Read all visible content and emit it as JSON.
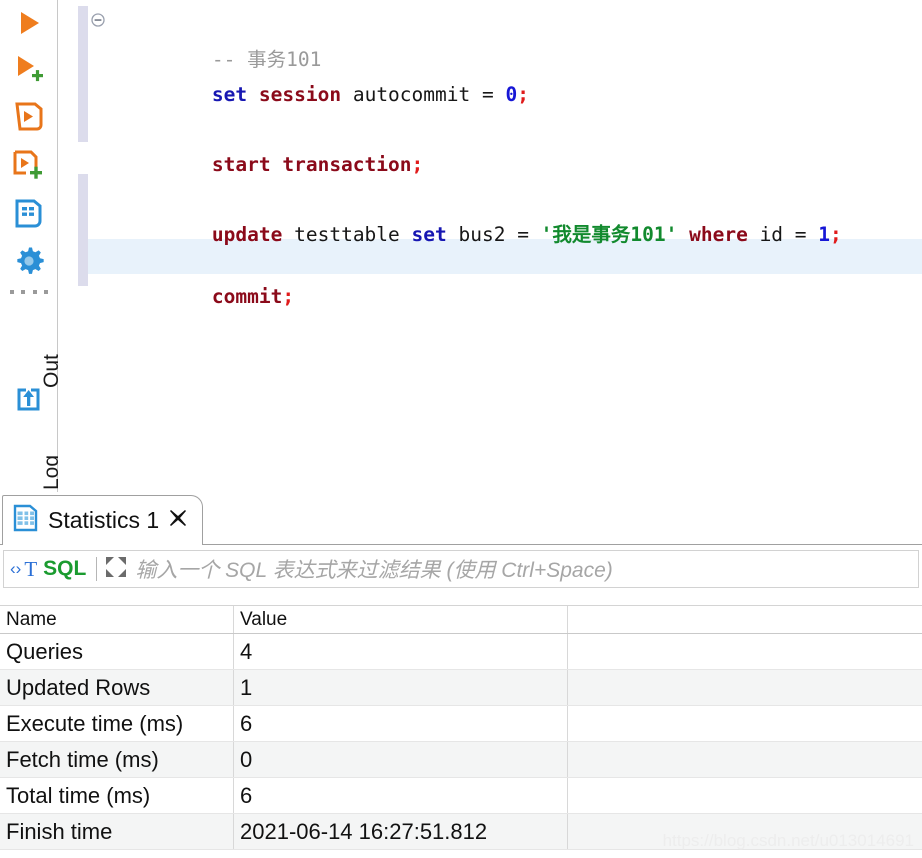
{
  "toolbar": {
    "items": [
      {
        "name": "execute-sql-statement-button",
        "icon": "play-icon",
        "title": "Execute SQL Statement"
      },
      {
        "name": "execute-sql-new-tab-button",
        "icon": "play-plus-icon",
        "title": "Execute SQL in new tab"
      },
      {
        "name": "execute-script-button",
        "icon": "script-execute-icon",
        "title": "Execute script"
      },
      {
        "name": "execute-script-new-tab-button",
        "icon": "script-execute-plus-icon",
        "title": "Execute script in new tab"
      },
      {
        "name": "explain-execution-plan-button",
        "icon": "execution-plan-icon",
        "title": "Explain execution plan"
      },
      {
        "name": "sql-editor-settings-button",
        "icon": "gear-icon",
        "title": "SQL Editor settings"
      }
    ],
    "drag_handle": "drag-dots-handle",
    "vertical_labels": [
      {
        "name": "output-panel-label",
        "text": "Out"
      },
      {
        "name": "log-panel-label",
        "text": "Log"
      }
    ],
    "output_icon": "export-output-icon"
  },
  "editor": {
    "fold_icon": "fold-collapse-icon",
    "lines": [
      {
        "name": "code-line-comment",
        "tokens": [
          {
            "t": "-- 事务101",
            "c": "tk-comment"
          }
        ]
      },
      {
        "name": "code-line-set-autocommit",
        "tokens": [
          {
            "t": "set",
            "c": "tk-kw-blue"
          },
          {
            "t": " ",
            "c": "tk-plain"
          },
          {
            "t": "session",
            "c": "tk-kw-red"
          },
          {
            "t": " autocommit = ",
            "c": "tk-plain"
          },
          {
            "t": "0",
            "c": "tk-num"
          },
          {
            "t": ";",
            "c": "tk-semi"
          }
        ]
      },
      {
        "name": "code-line-start-transaction",
        "tokens": [
          {
            "t": "start transaction",
            "c": "tk-kw-red"
          },
          {
            "t": ";",
            "c": "tk-semi"
          }
        ]
      },
      {
        "name": "code-line-update",
        "tokens": [
          {
            "t": "update",
            "c": "tk-kw-red"
          },
          {
            "t": " testtable ",
            "c": "tk-plain"
          },
          {
            "t": "set",
            "c": "tk-kw-blue"
          },
          {
            "t": " bus2 = ",
            "c": "tk-plain"
          },
          {
            "t": "'我是事务101'",
            "c": "tk-str"
          },
          {
            "t": " ",
            "c": "tk-plain"
          },
          {
            "t": "where",
            "c": "tk-kw-red"
          },
          {
            "t": " id = ",
            "c": "tk-plain"
          },
          {
            "t": "1",
            "c": "tk-num"
          },
          {
            "t": ";",
            "c": "tk-semi"
          }
        ]
      },
      {
        "name": "code-line-commit",
        "tokens": [
          {
            "t": "commit",
            "c": "tk-kw-red"
          },
          {
            "t": ";",
            "c": "tk-semi"
          }
        ]
      }
    ],
    "grip": "panel-resize-grip"
  },
  "results": {
    "tab": {
      "icon": "grid-table-icon",
      "label": "Statistics 1",
      "close_icon": "close-icon"
    },
    "filter": {
      "sql_badge_chevrons": "‹›",
      "sql_badge_t": "T",
      "sql_badge_text": "SQL",
      "expand_icon": "expand-arrows-icon",
      "placeholder": "输入一个 SQL 表达式来过滤结果 (使用 Ctrl+Space)",
      "value": ""
    },
    "table": {
      "columns": [
        "Name",
        "Value",
        ""
      ],
      "rows": [
        {
          "name": "Queries",
          "value": "4",
          "extra": ""
        },
        {
          "name": "Updated Rows",
          "value": "1",
          "extra": ""
        },
        {
          "name": "Execute time (ms)",
          "value": "6",
          "extra": ""
        },
        {
          "name": "Fetch time (ms)",
          "value": "0",
          "extra": ""
        },
        {
          "name": "Total time (ms)",
          "value": "6",
          "extra": ""
        },
        {
          "name": "Finish time",
          "value": "2021-06-14 16:27:51.812",
          "extra": ""
        }
      ]
    }
  },
  "watermark": "https://blog.csdn.net/u013014691",
  "colors": {
    "accent_orange": "#e8751a",
    "accent_blue": "#2a8fd6",
    "keyword_red": "#8b0a1a",
    "keyword_blue": "#1717b2",
    "string_green": "#128a2e",
    "semicolon_red": "#e01b1b",
    "comment_gray": "#9a9a9a",
    "fold_bar": "#dcdcec",
    "current_line": "#e8f2fb"
  }
}
